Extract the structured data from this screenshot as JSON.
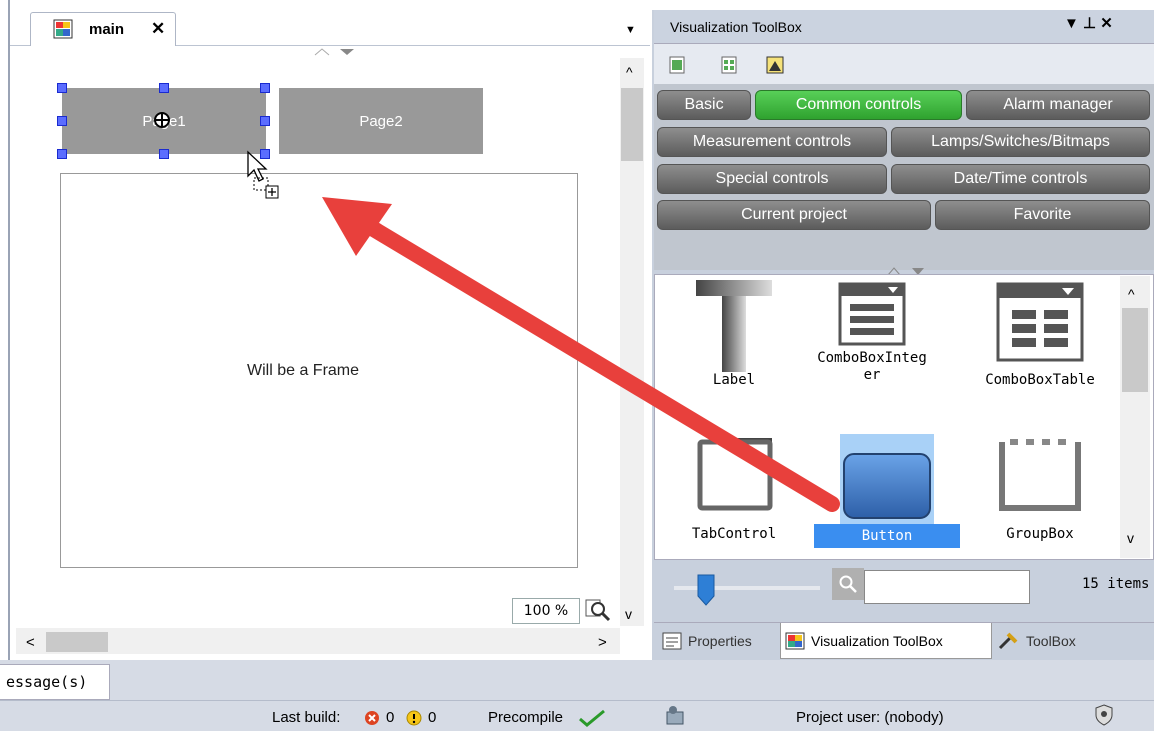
{
  "editor": {
    "tab_label": "main",
    "tab_close": "✕",
    "tab_dropdown": "▼",
    "page1_label": "Page1",
    "page2_label": "Page2",
    "frame_label": "Will be a Frame",
    "zoom": "100 %",
    "hscroll_left": "<",
    "hscroll_right": ">",
    "vscroll_up": "^",
    "vscroll_down": "v"
  },
  "toolbox": {
    "title": "Visualization ToolBox",
    "title_controls": "▼  ⊥  ✕",
    "categories": [
      {
        "label": "Basic",
        "active": false
      },
      {
        "label": "Common controls",
        "active": true
      },
      {
        "label": "Alarm manager",
        "active": false
      },
      {
        "label": "Measurement controls",
        "active": false
      },
      {
        "label": "Lamps/Switches/Bitmaps",
        "active": false
      },
      {
        "label": "Special controls",
        "active": false
      },
      {
        "label": "Date/Time controls",
        "active": false
      },
      {
        "label": "Current project",
        "active": false
      },
      {
        "label": "Favorite",
        "active": false
      }
    ],
    "items": [
      {
        "label": "Label",
        "icon": "label-icon"
      },
      {
        "label": "ComboBoxInteg\ner",
        "icon": "combobox-integer-icon"
      },
      {
        "label": "ComboBoxTable",
        "icon": "combobox-table-icon"
      },
      {
        "label": "TabControl",
        "icon": "tab-control-icon"
      },
      {
        "label": "Button",
        "icon": "button-icon",
        "selected": true
      },
      {
        "label": "GroupBox",
        "icon": "groupbox-icon"
      }
    ],
    "search_value": "",
    "items_count": "15 items",
    "bottom_tabs": [
      {
        "label": "Properties",
        "icon": "properties-icon"
      },
      {
        "label": "Visualization ToolBox",
        "icon": "visualization-toolbox-icon",
        "active": true
      },
      {
        "label": "ToolBox",
        "icon": "tools-icon"
      }
    ],
    "scroll_up": "^",
    "scroll_down": "v"
  },
  "messages": {
    "tab_label": "essage(s)"
  },
  "status": {
    "last_build_label": "Last build:",
    "errors": "0",
    "warnings": "0",
    "precompile_label": "Precompile",
    "project_user": "Project user: (nobody)"
  },
  "colors": {
    "active_category": "#3cb83c",
    "category": "#6e6e6e",
    "selection_handle": "#5b6dff",
    "arrow": "#e8403c",
    "button_item_highlight": "#3a8ef0"
  }
}
